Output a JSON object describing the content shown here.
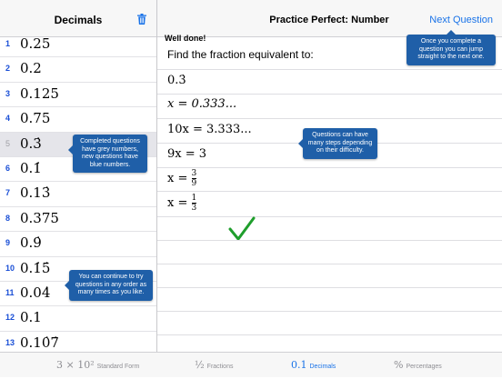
{
  "header": {
    "left_title": "Decimals",
    "main_title": "Practice Perfect: Number",
    "next_label": "Next Question"
  },
  "sidebar": {
    "items": [
      {
        "num": "1",
        "value": "0.25"
      },
      {
        "num": "2",
        "value": "0.2"
      },
      {
        "num": "3",
        "value": "0.125"
      },
      {
        "num": "4",
        "value": "0.75"
      },
      {
        "num": "5",
        "value": "0.3̇",
        "done": true
      },
      {
        "num": "6",
        "value": "0.1̇"
      },
      {
        "num": "7",
        "value": "0.13̇"
      },
      {
        "num": "8",
        "value": "0.375"
      },
      {
        "num": "9",
        "value": "0.9̇"
      },
      {
        "num": "10",
        "value": "0.1̇5̇"
      },
      {
        "num": "11",
        "value": "0.04̇"
      },
      {
        "num": "12",
        "value": "0.1"
      },
      {
        "num": "13",
        "value": "0.10̇7̇"
      }
    ]
  },
  "tips": {
    "completed": "Completed questions have grey numbers, new questions have blue numbers.",
    "any_order": "You can continue to try questions in any order as many times as you like.",
    "next": "Once you complete a question you can jump straight to the next one.",
    "steps": "Questions can have many steps depending on their difficulty."
  },
  "main": {
    "feedback": "Well done!",
    "prompt": "Find the fraction equivalent to:",
    "steps": {
      "s1": "0.3̇",
      "s2": "x = 0.333...",
      "s3": "10x = 3.333...",
      "s4": "9x = 3",
      "s5_lhs": "x = ",
      "s5_num": "3",
      "s5_den": "9",
      "s6_lhs": "x = ",
      "s6_num": "1",
      "s6_den": "3"
    }
  },
  "tabs": {
    "standard_icon": "3 × 10²",
    "standard_label": "Standard Form",
    "fractions_icon": "½",
    "fractions_label": "Fractions",
    "decimals_icon": "0.1",
    "decimals_label": "Decimals",
    "percent_icon": "%",
    "percent_label": "Percentages"
  }
}
